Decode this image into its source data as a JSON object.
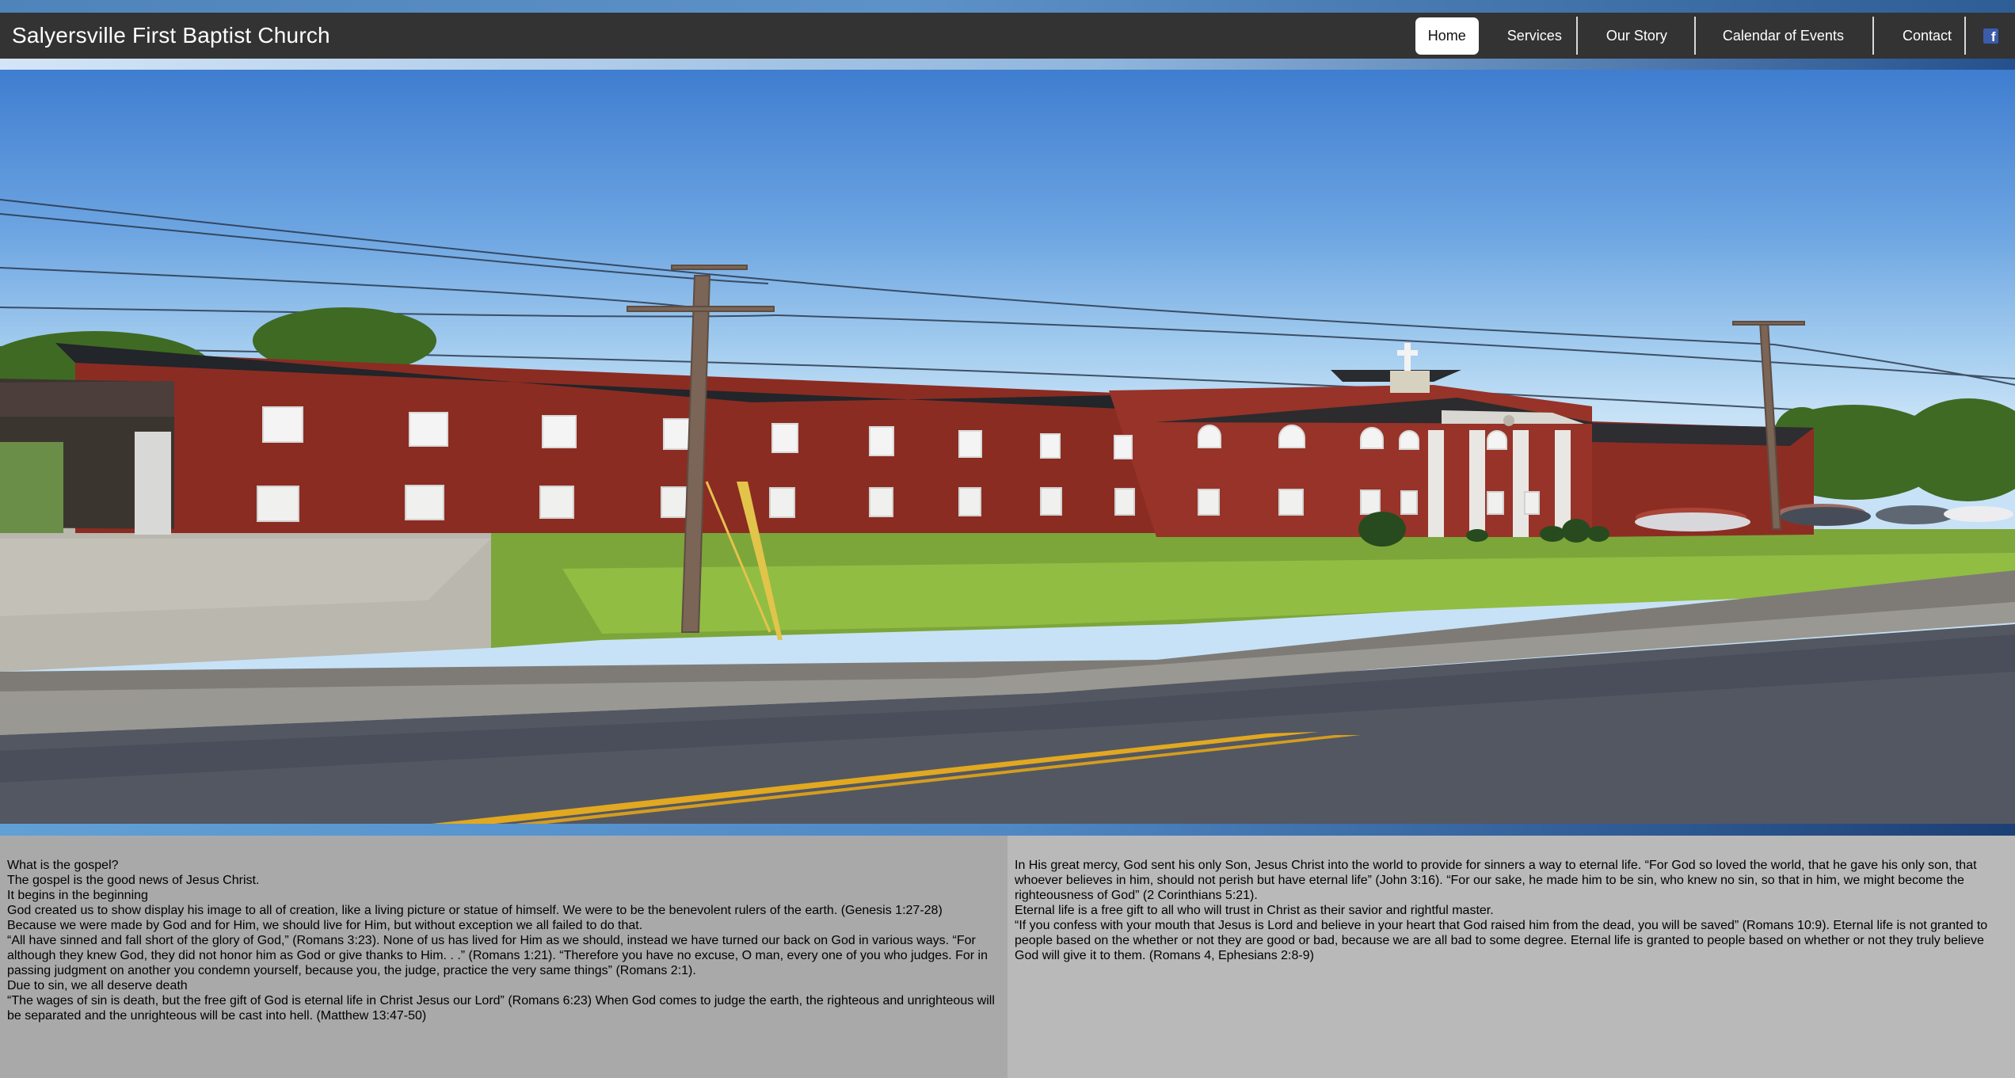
{
  "header": {
    "site_title": "Salyersville First Baptist Church"
  },
  "nav": {
    "items": [
      {
        "label": "Home",
        "active": true
      },
      {
        "label": "Services",
        "active": false
      },
      {
        "label": "Our Story",
        "active": false
      },
      {
        "label": "Calendar of Events",
        "active": false
      },
      {
        "label": "Contact",
        "active": false
      }
    ],
    "social_icon": "facebook-icon",
    "social_glyph": "f"
  },
  "colors": {
    "navbar": "#333333",
    "accent_blue": "#4f88c5",
    "facebook": "#3b5cab"
  },
  "content": {
    "left": [
      "What is the gospel?",
      "The gospel is the good news of Jesus Christ.",
      "It begins in the beginning",
      "God created us to show display his image to all of creation, like a living picture or statue of himself. We were to be the benevolent rulers of the earth. (Genesis 1:27-28)",
      "Because we were made by God and for Him, we should live for Him, but without exception we all failed to do that.",
      "“All have sinned and fall short of the glory of God,” (Romans 3:23). None of us has lived for Him as we should, instead we have turned our back on God in various ways. “For although they knew God, they did not honor him as God or give thanks to Him. . .” (Romans 1:21). “Therefore you have no excuse, O man, every one of you who judges. For in passing judgment on another you condemn yourself, because you, the judge, practice the very same things” (Romans 2:1).",
      "Due to sin, we all deserve death",
      "“The wages of sin is death, but the free gift of God is eternal life in Christ Jesus our Lord” (Romans 6:23) When God comes to judge the earth, the righteous and unrighteous will be separated and the unrighteous will be cast into hell. (Matthew 13:47-50)"
    ],
    "right": [
      "In His great mercy, God sent his only Son, Jesus Christ into the world to provide for sinners a way to eternal life. “For God so loved the world, that he gave his only son, that whoever believes in him, should not perish but have eternal life” (John 3:16). “For our sake, he made him to be sin, who knew no sin, so that in him, we might become the righteousness of God” (2 Corinthians 5:21).",
      "Eternal life is a free gift to all who will trust in Christ as their savior and rightful master.",
      "“If you confess with your mouth that Jesus is Lord and believe in your heart that God raised him from the dead, you will be saved” (Romans 10:9). Eternal life is not granted to people based on the whether or not they are good or bad, because we are all bad to some degree. Eternal life is granted to people based on whether or not they truly believe God will give it to them. (Romans 4, Ephesians 2:8-9)"
    ]
  }
}
